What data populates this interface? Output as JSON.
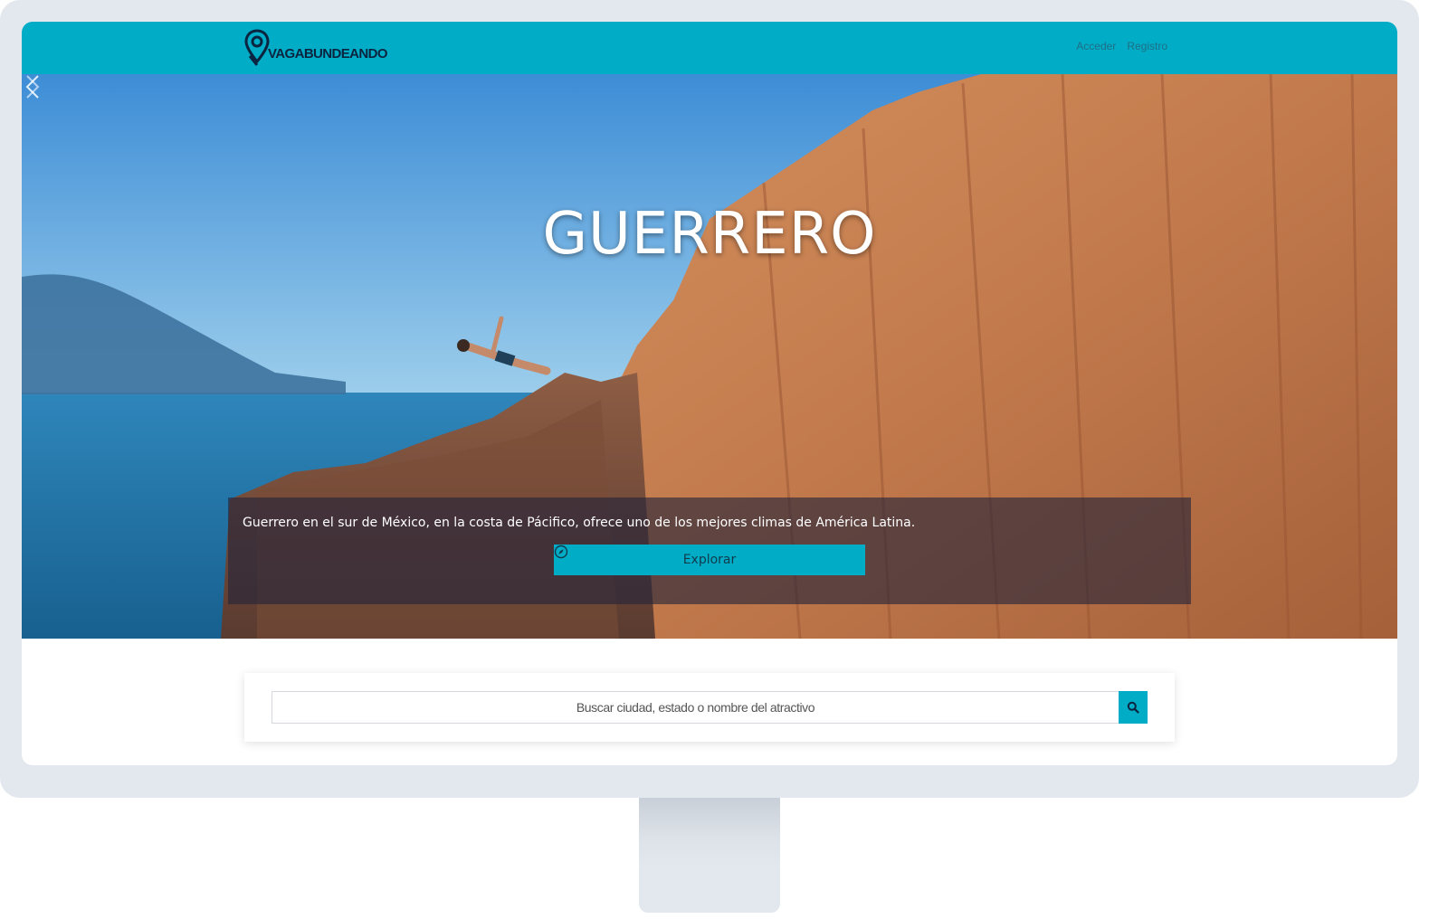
{
  "brand": {
    "logo_text": "VAGABUNDEANDO",
    "primary_color": "#00acc6",
    "logo_color": "#0b2440"
  },
  "nav": {
    "login_label": "Acceder",
    "register_label": "Registro"
  },
  "hero": {
    "title": "GUERRERO",
    "caption": "Guerrero en el sur de México, en la costa de Pácifico, ofrece uno de los mejores climas de América Latina.",
    "explore_label": "Explorar",
    "explore_icon": "compass-icon",
    "prev_icon": "chevron-left-icon",
    "next_icon": "chevron-right-icon"
  },
  "search": {
    "placeholder": "Buscar ciudad, estado o nombre del atractivo",
    "button_icon": "search-icon"
  }
}
